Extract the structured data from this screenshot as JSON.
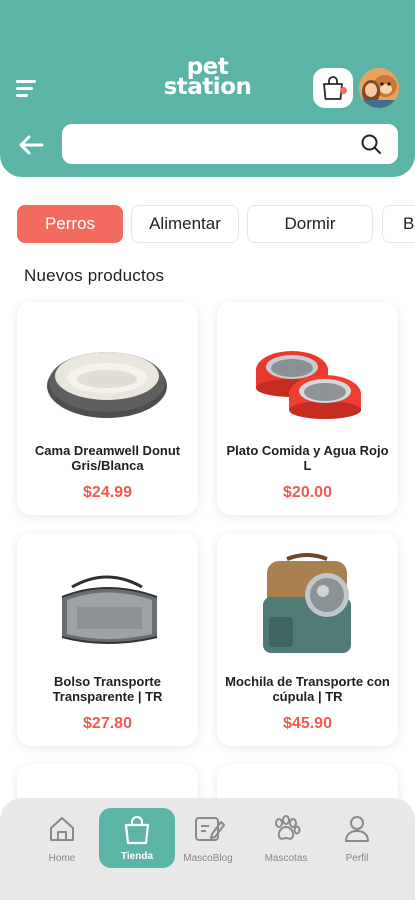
{
  "brand": {
    "line1": "pet",
    "line2": "station",
    "primary": "#5cb4a7",
    "accent": "#f36b5f"
  },
  "header": {
    "menu_icon": "hamburger-icon",
    "cart_icon": "shopping-bag-icon",
    "avatar": "user-avatar",
    "back_icon": "arrow-left-icon",
    "search": {
      "value": "",
      "placeholder": "",
      "icon": "search-icon"
    }
  },
  "categories": {
    "items": [
      {
        "label": "Perros",
        "active": true
      },
      {
        "label": "Alimentar",
        "active": false
      },
      {
        "label": "Dormir",
        "active": false
      },
      {
        "label": "B",
        "active": false
      }
    ]
  },
  "section": {
    "title": "Nuevos productos"
  },
  "products": [
    {
      "name": "Cama Dreamwell Donut Gris/Blanca",
      "price": "$24.99",
      "image": "pet-bed-image"
    },
    {
      "name": "Plato Comida y Agua Rojo L",
      "price": "$20.00",
      "image": "double-bowl-image"
    },
    {
      "name": "Bolso Transporte Transparente | TR",
      "price": "$27.80",
      "image": "carrier-bag-image"
    },
    {
      "name": "Mochila de Transporte con cúpula | TR",
      "price": "$45.90",
      "image": "dome-backpack-image"
    }
  ],
  "nav": {
    "items": [
      {
        "label": "Home",
        "icon": "home-icon",
        "active": false
      },
      {
        "label": "Tienda",
        "icon": "shop-bag-icon",
        "active": true
      },
      {
        "label": "MascoBlog",
        "icon": "blog-edit-icon",
        "active": false
      },
      {
        "label": "Mascotas",
        "icon": "paw-icon",
        "active": false
      },
      {
        "label": "Perfil",
        "icon": "profile-icon",
        "active": false
      }
    ]
  }
}
